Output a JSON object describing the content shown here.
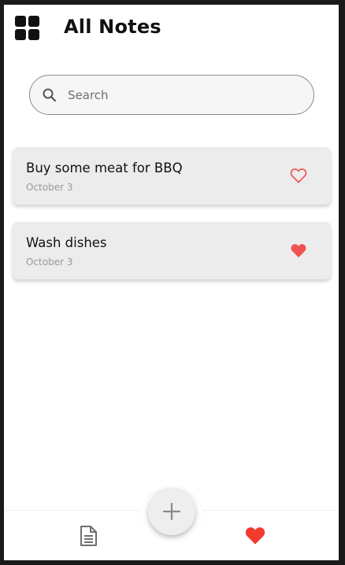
{
  "header": {
    "title": "All Notes",
    "menu_icon": "grid-icon"
  },
  "search": {
    "placeholder": "Search",
    "icon": "search-icon"
  },
  "notes": [
    {
      "title": "Buy some meat for BBQ",
      "date": "October 3",
      "favorite": false
    },
    {
      "title": "Wash dishes",
      "date": "October 3",
      "favorite": true
    }
  ],
  "bottom_nav": {
    "items": [
      "notes-icon",
      "heart-icon"
    ],
    "fab_icon": "plus-icon"
  },
  "colors": {
    "accent": "#f05151",
    "card": "#ececec",
    "text": "#111111",
    "muted": "#9a9a9a"
  }
}
